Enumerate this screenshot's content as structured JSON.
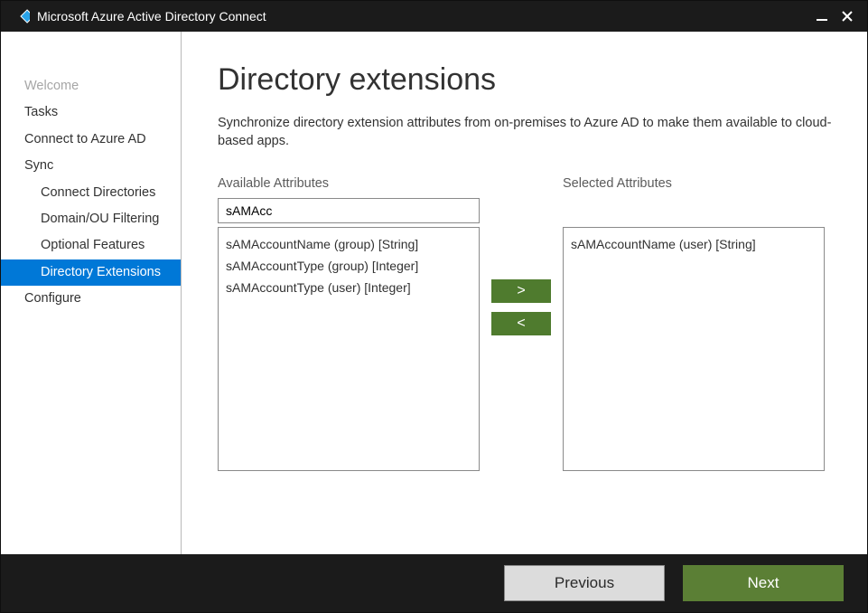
{
  "window": {
    "title": "Microsoft Azure Active Directory Connect"
  },
  "nav": {
    "items": [
      {
        "label": "Welcome",
        "cls": "disabled"
      },
      {
        "label": "Tasks",
        "cls": ""
      },
      {
        "label": "Connect to Azure AD",
        "cls": ""
      },
      {
        "label": "Sync",
        "cls": ""
      },
      {
        "label": "Connect Directories",
        "cls": "sub"
      },
      {
        "label": "Domain/OU Filtering",
        "cls": "sub"
      },
      {
        "label": "Optional Features",
        "cls": "sub"
      },
      {
        "label": "Directory Extensions",
        "cls": "sub active"
      },
      {
        "label": "Configure",
        "cls": ""
      }
    ]
  },
  "page": {
    "heading": "Directory extensions",
    "description": "Synchronize directory extension attributes from on-premises to Azure AD to make them available to cloud-based apps.",
    "available_label": "Available Attributes",
    "selected_label": "Selected Attributes",
    "search_value": "sAMAcc",
    "available": [
      "sAMAccountName (group) [String]",
      "sAMAccountType (group) [Integer]",
      "sAMAccountType (user) [Integer]"
    ],
    "selected": [
      "sAMAccountName (user) [String]"
    ],
    "add_symbol": ">",
    "remove_symbol": "<"
  },
  "footer": {
    "previous": "Previous",
    "next": "Next"
  }
}
